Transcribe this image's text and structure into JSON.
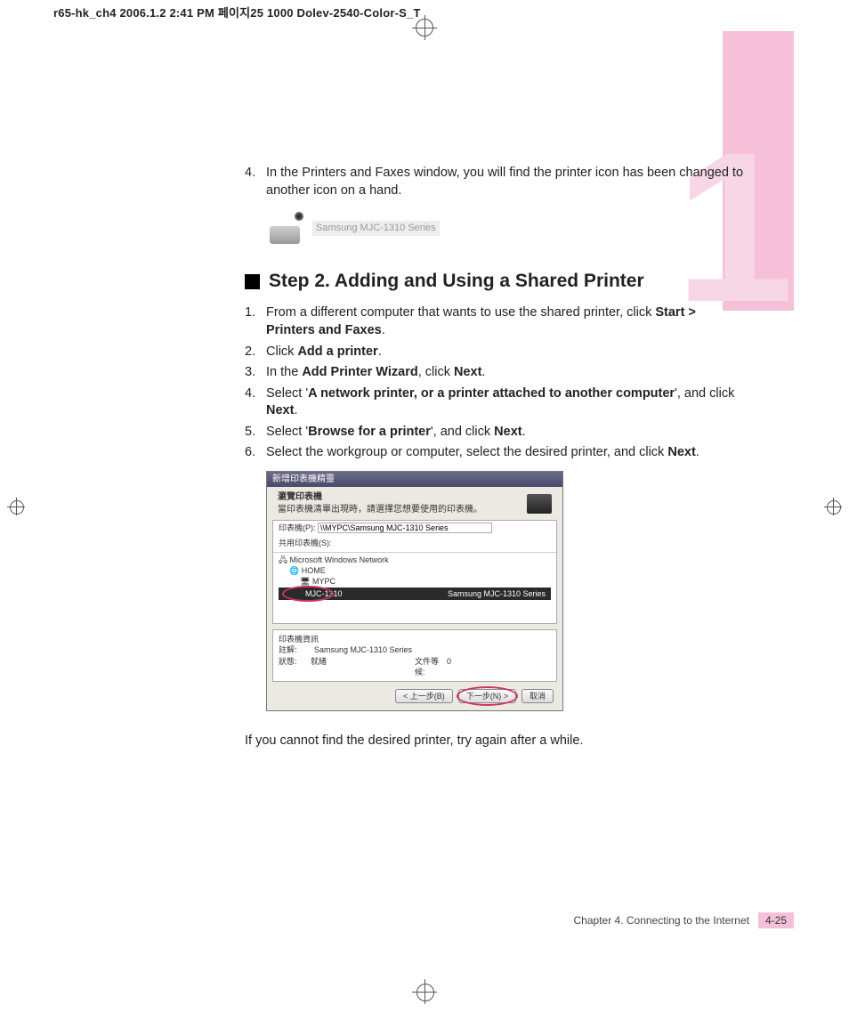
{
  "header": {
    "text_full": "r65-hk_ch4  2006.1.2 2:41 PM  페이지25   1000 Dolev-2540-Color-S_T"
  },
  "tab": {
    "numeral": "1"
  },
  "intro_item": {
    "num": "4.",
    "text_a": "In the Printers and Faxes window, you will find the printer icon has been changed to another icon on a hand."
  },
  "printer_label": "Samsung MJC-1310 Series",
  "step_heading": "Step 2. Adding and Using a Shared Printer",
  "steps": [
    {
      "num": "1.",
      "parts": [
        "From a different computer that wants to use the shared printer, click ",
        {
          "b": "Start > Printers and Faxes"
        },
        "."
      ]
    },
    {
      "num": "2.",
      "parts": [
        "Click ",
        {
          "b": "Add a printer"
        },
        "."
      ]
    },
    {
      "num": "3.",
      "parts": [
        "In the ",
        {
          "b": "Add Printer Wizard"
        },
        ", click ",
        {
          "b": "Next"
        },
        "."
      ]
    },
    {
      "num": "4.",
      "parts": [
        "Select '",
        {
          "b": "A network printer, or a printer attached to another computer"
        },
        "', and click ",
        {
          "b": "Next"
        },
        "."
      ]
    },
    {
      "num": "5.",
      "parts": [
        "Select '",
        {
          "b": "Browse for a printer"
        },
        "', and click ",
        {
          "b": "Next"
        },
        "."
      ]
    },
    {
      "num": "6.",
      "parts": [
        "Select the workgroup or computer, select the desired printer, and click ",
        {
          "b": "Next"
        },
        "."
      ]
    }
  ],
  "dialog": {
    "title": "新增印表機精靈",
    "sub_bold": "瀏覽印表機",
    "sub_text": "當印表機清單出現時，請選擇您想要使用的印表機。",
    "path_label": "印表機(P):",
    "path_value": "\\\\MYPC\\Samsung MJC-1310 Series",
    "shared_label": "共用印表機(S):",
    "tree_root": "Microsoft Windows Network",
    "tree_home": "HOME",
    "tree_pc": "MYPC",
    "sel_left": "MJC-1310",
    "sel_right": "Samsung MJC-1310 Series",
    "info_header": "印表機資訊",
    "info_k1": "註解:",
    "info_v1": "Samsung MJC-1310 Series",
    "info_k2": "狀態:",
    "info_v2": "就緒",
    "info_k3": "文件等候:",
    "info_v3": "0",
    "btn_back": "< 上一步(B)",
    "btn_next": "下一步(N) >",
    "btn_cancel": "取消"
  },
  "after_note": "If you cannot find the desired printer, try again after a while.",
  "footer": {
    "chapter": "Chapter 4. Connecting to the Internet",
    "page": "4-25"
  }
}
